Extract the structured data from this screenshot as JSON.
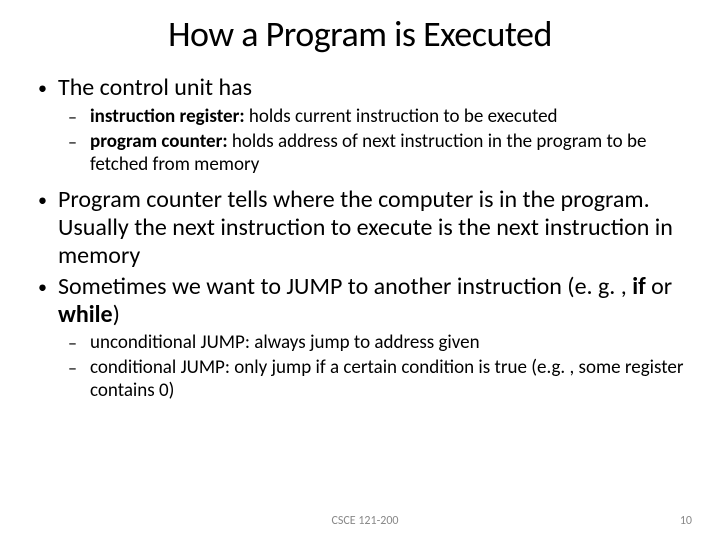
{
  "title": "How a Program is Executed",
  "bullets": {
    "b1": "The control unit has",
    "b1a_bold": "instruction register:",
    "b1a_rest": "  holds current instruction to be executed",
    "b1b_bold": "program counter:",
    "b1b_rest": "  holds address of next instruction in the program to be fetched from memory",
    "b2": "Program counter tells where the computer is in the program.  Usually the next instruction to execute is the next instruction in memory",
    "b3_pre": "Sometimes we want to JUMP to another instruction (e. g. , ",
    "b3_bold1": "if",
    "b3_mid": " or ",
    "b3_bold2": "while",
    "b3_post": ")",
    "b3a": "unconditional JUMP:  always jump to address given",
    "b3b": "conditional JUMP:  only jump if a certain condition is true (e.g. , some register contains 0)"
  },
  "footer": {
    "course": "CSCE 121-200",
    "page": "10"
  }
}
